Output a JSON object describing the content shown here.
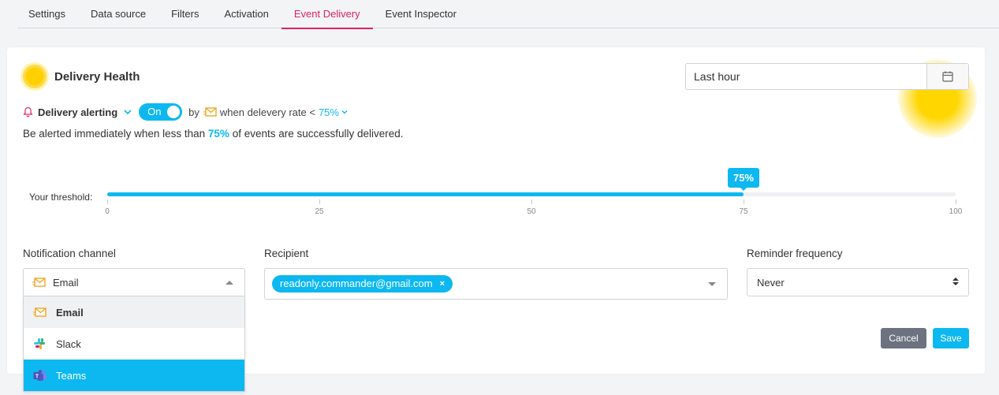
{
  "tabs": [
    "Settings",
    "Data source",
    "Filters",
    "Activation",
    "Event Delivery",
    "Event Inspector"
  ],
  "active_tab": "Event Delivery",
  "health": {
    "title": "Delivery Health"
  },
  "period": {
    "value": "Last hour"
  },
  "alerting": {
    "label": "Delivery alerting",
    "toggle": "On",
    "by": "by",
    "condition": "when delevery rate <",
    "rate": "75%"
  },
  "description": {
    "before": "Be alerted immediately when less than",
    "pct": "75%",
    "after": "of events are successfully delivered."
  },
  "threshold": {
    "label": "Your threshold:",
    "value": 75,
    "value_label": "75%",
    "ticks": [
      "0",
      "25",
      "50",
      "75",
      "100"
    ]
  },
  "notification": {
    "label": "Notification channel",
    "selected": "Email",
    "options": [
      {
        "label": "Email",
        "icon": "email-icon"
      },
      {
        "label": "Slack",
        "icon": "slack-icon"
      },
      {
        "label": "Teams",
        "icon": "teams-icon"
      }
    ]
  },
  "recipient": {
    "label": "Recipient",
    "chip": "readonly.commander@gmail.com",
    "chip_remove": "×"
  },
  "reminder": {
    "label": "Reminder frequency",
    "value": "Never"
  },
  "buttons": {
    "cancel": "Cancel",
    "save": "Save"
  },
  "colors": {
    "accent": "#0db8f0",
    "active_tab": "#e0245e",
    "health": "#ffd000"
  }
}
